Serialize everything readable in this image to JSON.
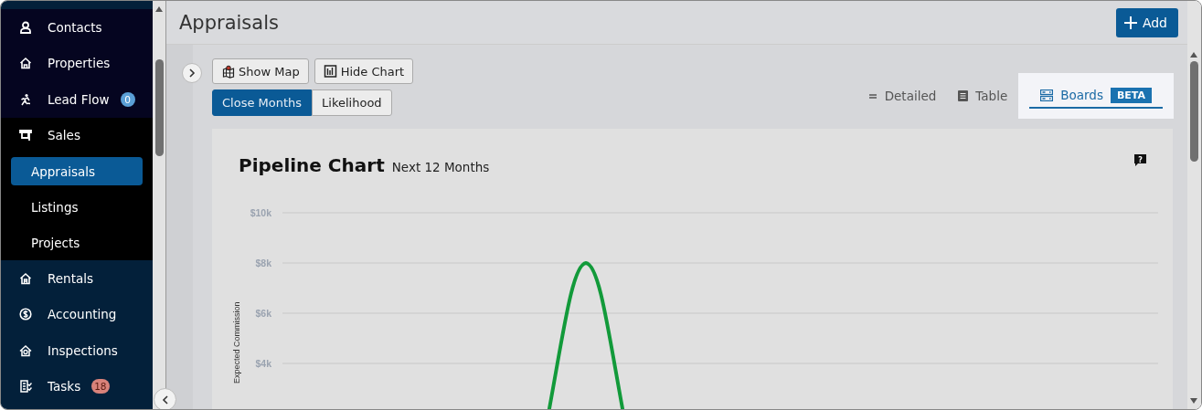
{
  "sidebar": {
    "items": [
      {
        "label": "Contacts",
        "selected": false,
        "expanded": false
      },
      {
        "label": "Properties",
        "selected": false,
        "expanded": false
      },
      {
        "label": "Lead Flow",
        "selected": false,
        "expanded": false,
        "badge": {
          "text": "0",
          "color": "#5a9fd6"
        }
      },
      {
        "label": "Sales",
        "selected": false,
        "expanded": true,
        "children": [
          {
            "label": "Appraisals",
            "selected": true
          },
          {
            "label": "Listings",
            "selected": false
          },
          {
            "label": "Projects",
            "selected": false
          }
        ]
      },
      {
        "label": "Rentals",
        "selected": false,
        "expanded": false
      },
      {
        "label": "Accounting",
        "selected": false,
        "expanded": false
      },
      {
        "label": "Inspections",
        "selected": false,
        "expanded": false
      },
      {
        "label": "Tasks",
        "selected": false,
        "expanded": false,
        "badge": {
          "text": "18",
          "color": "#d9827a"
        }
      }
    ]
  },
  "header": {
    "title": "Appraisals",
    "add_button": "Add"
  },
  "toolbar": {
    "buttons": [
      "Show Map",
      "Hide Chart"
    ],
    "segments": [
      {
        "label": "Close Months",
        "selected": true
      },
      {
        "label": "Likelihood",
        "selected": false
      }
    ],
    "views": [
      {
        "label": "Detailed",
        "selected": false
      },
      {
        "label": "Table",
        "selected": false
      },
      {
        "label": "Boards",
        "selected": true,
        "badge": "BETA"
      }
    ]
  },
  "chart": {
    "title": "Pipeline Chart",
    "subtitle": "Next 12 Months",
    "help_icon": "?",
    "y_axis_label": "Expected Commission",
    "y_ticks": [
      "$10k",
      "$8k",
      "$6k",
      "$4k"
    ]
  }
}
